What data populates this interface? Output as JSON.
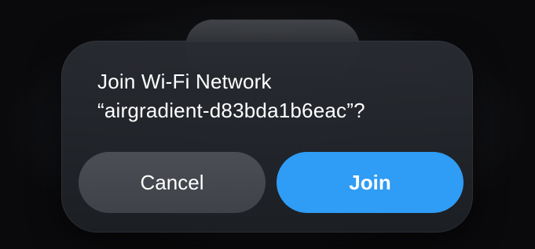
{
  "dialog": {
    "title_line1": "Join Wi-Fi Network",
    "title_line2": "“airgradient-d83bda1b6eac”?",
    "cancel_label": "Cancel",
    "join_label": "Join"
  },
  "colors": {
    "join_button": "#2f9cf5",
    "cancel_button": "#46494f",
    "dialog_background": "#24272c",
    "text": "#ffffff"
  }
}
